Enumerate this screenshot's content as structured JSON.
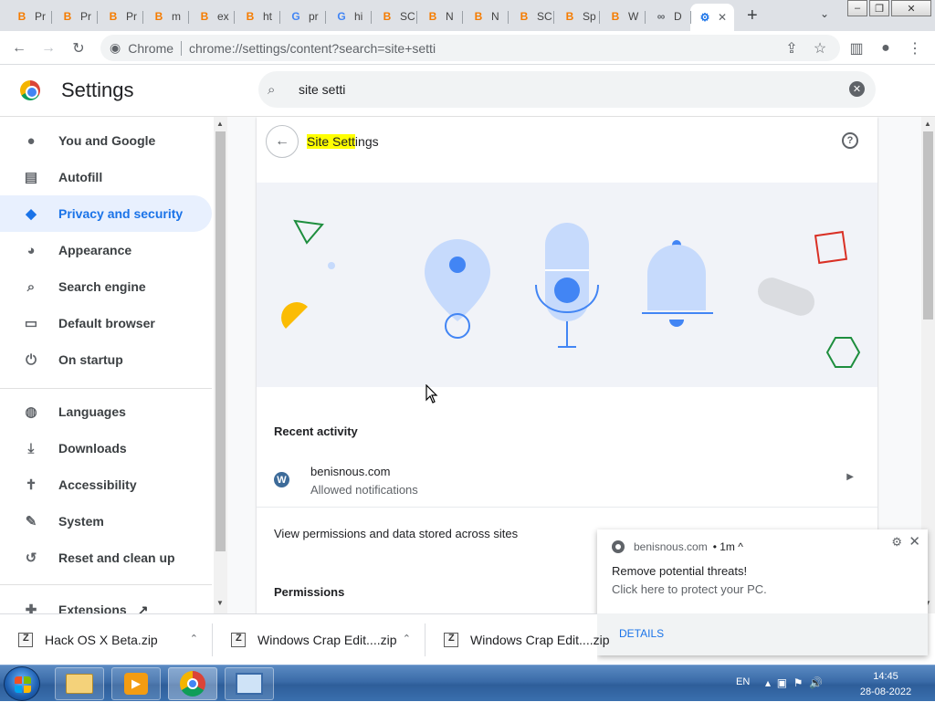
{
  "tabs": [
    {
      "icon": "blogger-icon",
      "glyph": "B",
      "label": "Pr"
    },
    {
      "icon": "blogger-icon",
      "glyph": "B",
      "label": "Pr"
    },
    {
      "icon": "blogger-icon",
      "glyph": "B",
      "label": "Pr"
    },
    {
      "icon": "blogger-icon",
      "glyph": "B",
      "label": "m"
    },
    {
      "icon": "blogger-icon",
      "glyph": "B",
      "label": "ex"
    },
    {
      "icon": "blogger-icon",
      "glyph": "B",
      "label": "ht"
    },
    {
      "icon": "google-icon",
      "glyph": "G",
      "label": "pr"
    },
    {
      "icon": "google-icon",
      "glyph": "G",
      "label": "hi"
    },
    {
      "icon": "blogger-icon",
      "glyph": "B",
      "label": "SC"
    },
    {
      "icon": "blogger-icon",
      "glyph": "B",
      "label": "N"
    },
    {
      "icon": "blogger-icon",
      "glyph": "B",
      "label": "N"
    },
    {
      "icon": "blogger-icon",
      "glyph": "B",
      "label": "SC"
    },
    {
      "icon": "blogger-icon",
      "glyph": "B",
      "label": "Sp"
    },
    {
      "icon": "blogger-icon",
      "glyph": "B",
      "label": "W"
    },
    {
      "icon": "link-icon",
      "glyph": "∞",
      "label": "D"
    }
  ],
  "active_tab": {
    "icon": "gear-icon",
    "close": "✕"
  },
  "new_tab": "+",
  "address": {
    "chip": "Chrome",
    "url": "chrome://settings/content?search=site+setti"
  },
  "settings": {
    "title": "Settings",
    "search_value": "site setti"
  },
  "sidebar": {
    "items": [
      {
        "label": "You and Google",
        "icon": "person-icon",
        "glyph": "●"
      },
      {
        "label": "Autofill",
        "icon": "clipboard-icon",
        "glyph": "▤"
      },
      {
        "label": "Privacy and security",
        "icon": "shield-icon",
        "glyph": "◆",
        "active": true
      },
      {
        "label": "Appearance",
        "icon": "palette-icon",
        "glyph": "◕"
      },
      {
        "label": "Search engine",
        "icon": "search-icon",
        "glyph": "⌕"
      },
      {
        "label": "Default browser",
        "icon": "browser-icon",
        "glyph": "▭"
      },
      {
        "label": "On startup",
        "icon": "power-icon",
        "glyph": "⏻"
      },
      {
        "label": "Languages",
        "icon": "globe-icon",
        "glyph": "◍"
      },
      {
        "label": "Downloads",
        "icon": "download-icon",
        "glyph": "⤓"
      },
      {
        "label": "Accessibility",
        "icon": "accessibility-icon",
        "glyph": "✝"
      },
      {
        "label": "System",
        "icon": "wrench-icon",
        "glyph": "✎"
      },
      {
        "label": "Reset and clean up",
        "icon": "history-icon",
        "glyph": "↺"
      },
      {
        "label": "Extensions",
        "icon": "puzzle-icon",
        "glyph": "✚"
      }
    ]
  },
  "content": {
    "title_highlight": "Site Sett",
    "title_rest": "ings",
    "recent_activity": "Recent activity",
    "recent_site": "benisnous.com",
    "recent_status": "Allowed notifications",
    "view_permissions": "View permissions and data stored across sites",
    "permissions": "Permissions"
  },
  "notification": {
    "source": "benisnous.com",
    "time": "• 1m ^",
    "title": "Remove potential threats!",
    "body": "Click here to protect your PC.",
    "action": "DETAILS"
  },
  "downloads": [
    {
      "name": "Hack OS X Beta.zip"
    },
    {
      "name": "Windows Crap Edit....zip"
    },
    {
      "name": "Windows Crap Edit....zip"
    }
  ],
  "tray": {
    "lang": "EN",
    "time": "14:45",
    "date": "28-08-2022"
  },
  "colors": {
    "accent": "#1a73e8",
    "highlight": "#ffff00",
    "active_nav_bg": "#e8f0fe"
  }
}
